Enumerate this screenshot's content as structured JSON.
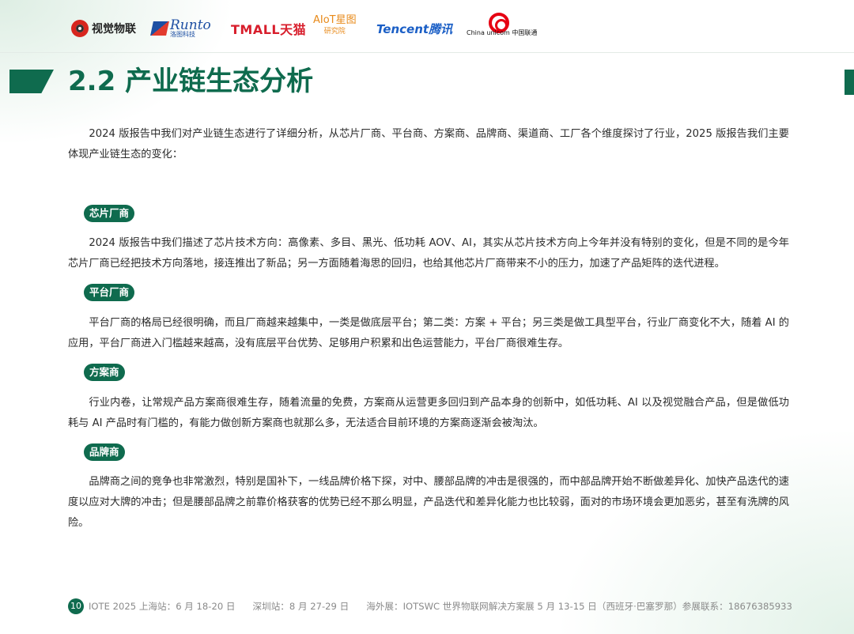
{
  "logos": {
    "shijue": "视觉物联",
    "runto_main": "Runto",
    "runto_sub": "洛图科技",
    "tmall": "TMALL天猫",
    "aiot_top": "AIoT星图",
    "aiot_bottom": "研究院",
    "tencent": "Tencent腾讯",
    "unicom_en": "China unicom",
    "unicom_cn": "中国联通"
  },
  "title": "2.2  产业链生态分析",
  "intro": "2024 版报告中我们对产业链生态进行了详细分析，从芯片厂商、平台商、方案商、品牌商、渠道商、工厂各个维度探讨了行业，2025 版报告我们主要体现产业链生态的变化：",
  "sections": [
    {
      "label": "芯片厂商",
      "text": "2024 版报告中我们描述了芯片技术方向：高像素、多目、黑光、低功耗 AOV、AI，其实从芯片技术方向上今年并没有特别的变化，但是不同的是今年芯片厂商已经把技术方向落地，接连推出了新品；另一方面随着海思的回归，也给其他芯片厂商带来不小的压力，加速了产品矩阵的迭代进程。"
    },
    {
      "label": "平台厂商",
      "text": "平台厂商的格局已经很明确，而且厂商越来越集中，一类是做底层平台；第二类：方案 + 平台；另三类是做工具型平台，行业厂商变化不大，随着 AI 的应用，平台厂商进入门槛越来越高，没有底层平台优势、足够用户积累和出色运营能力，平台厂商很难生存。"
    },
    {
      "label": "方案商",
      "text": "行业内卷，让常规产品方案商很难生存，随着流量的免费，方案商从运营更多回归到产品本身的创新中，如低功耗、AI 以及视觉融合产品，但是做低功耗与 AI 产品时有门槛的，有能力做创新方案商也就那么多，无法适合目前环境的方案商逐渐会被淘汰。"
    },
    {
      "label": "品牌商",
      "text": "品牌商之间的竞争也非常激烈，特别是国补下，一线品牌价格下探，对中、腰部品牌的冲击是很强的，而中部品牌开始不断做差异化、加快产品迭代的速度以应对大牌的冲击；但是腰部品牌之前靠价格获客的优势已经不那么明显，产品迭代和差异化能力也比较弱，面对的市场环境会更加恶劣，甚至有洗牌的风险。"
    }
  ],
  "footer": {
    "page": "10",
    "seg1": "IOTE 2025 上海站：6 月 18-20 日",
    "seg2": "深圳站：8 月 27-29 日",
    "seg3": "海外展：IOTSWC 世界物联网解决方案展 5 月 13-15 日（西班牙·巴塞罗那）参展联系：18676385933"
  },
  "colors": {
    "accent": "#0f6b4e",
    "text": "#2b2b2b",
    "footer_text": "#8a8a8a"
  }
}
